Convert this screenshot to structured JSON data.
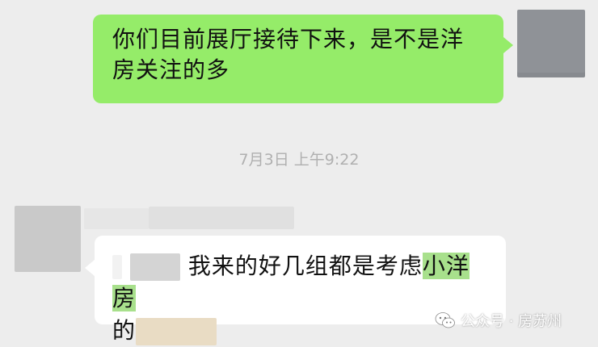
{
  "chat": {
    "sent_message": {
      "line1": "你们目前展厅接待下来，是不是洋",
      "line2": "房关注的多"
    },
    "timestamp": "7月3日 上午9:22",
    "received_message": {
      "line1_prefix": "",
      "line1_main": "我来的好几组都是考虑",
      "line1_highlight": "小洋房",
      "line2_prefix": "的",
      "highlight_color": "#a8e08c"
    }
  },
  "watermark": {
    "text": "公众号 · 房苏州"
  },
  "colors": {
    "background": "#ededed",
    "sent_bubble": "#95ec69",
    "received_bubble": "#ffffff",
    "timestamp": "#b0b0b0"
  },
  "icons": {
    "watermark_icon": "wechat-official-account-icon"
  }
}
